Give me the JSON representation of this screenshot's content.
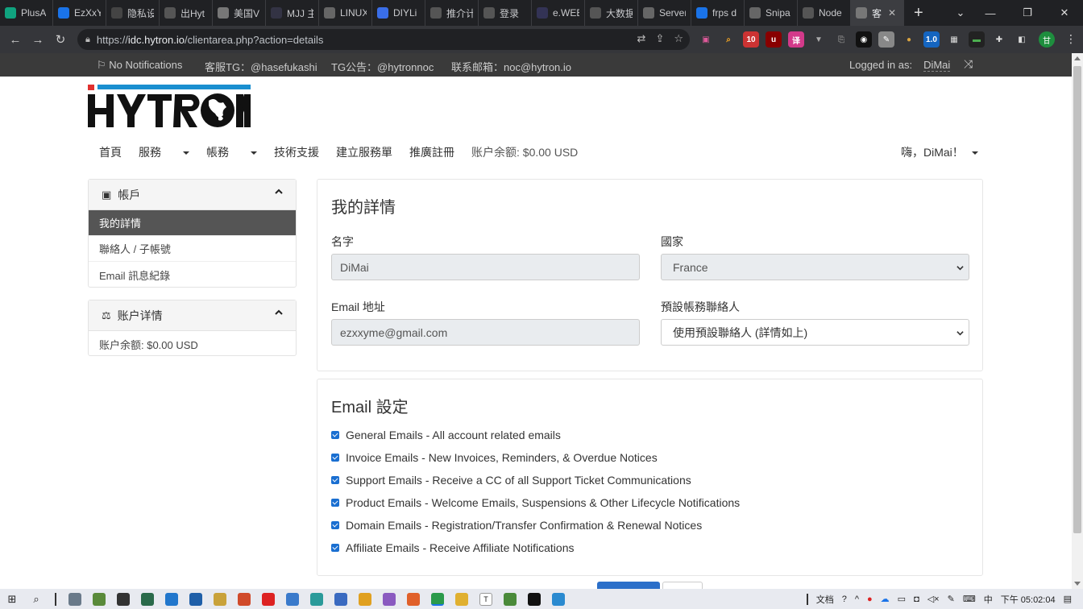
{
  "browser": {
    "tabs": [
      {
        "title": "PlusA",
        "color": "#10a37f",
        "w": 66
      },
      {
        "title": "EzXxY",
        "color": "#1a73e8",
        "w": 66
      },
      {
        "title": "隐私设置链",
        "color": "#444",
        "w": 66
      },
      {
        "title": "出Hyt",
        "color": "#555",
        "w": 66
      },
      {
        "title": "美国V",
        "color": "#777",
        "w": 66
      },
      {
        "title": "MJJ 主",
        "color": "#334",
        "w": 66
      },
      {
        "title": "LINUX",
        "color": "#666",
        "w": 66
      },
      {
        "title": "DIYLi",
        "color": "#3a6ee8",
        "w": 66
      },
      {
        "title": "推介计",
        "color": "#555",
        "w": 66
      },
      {
        "title": "登录",
        "color": "#555",
        "w": 66
      },
      {
        "title": "e.WEB",
        "color": "#335",
        "w": 66
      },
      {
        "title": "大数据",
        "color": "#555",
        "w": 66
      },
      {
        "title": "Server",
        "color": "#666",
        "w": 66
      },
      {
        "title": "frps d",
        "color": "#1a73e8",
        "w": 66
      },
      {
        "title": "Snipa",
        "color": "#666",
        "w": 66
      },
      {
        "title": "Node",
        "color": "#555",
        "w": 66
      },
      {
        "title": "客",
        "color": "#777",
        "w": 66,
        "active": true
      }
    ],
    "address": "https://idc.hytron.io/clientarea.php?action=details",
    "address_host": "idc.hytron.io",
    "address_prefix": "https://",
    "address_path": "/clientarea.php?action=details",
    "profile_initial": "甘"
  },
  "topbar": {
    "notifications": "No Notifications",
    "support_tg": "客服TG：@hasefukashi",
    "tg_announce": "TG公告：@hytronnoc",
    "email": "联系邮箱：noc@hytron.io",
    "logged_in_label": "Logged in as:",
    "logged_in_user": "DiMai"
  },
  "nav": {
    "home": "首頁",
    "services": "服務",
    "billing": "帳務",
    "support": "技術支援",
    "ticket": "建立服務單",
    "affiliate": "推廣註冊",
    "balance": "账户余额: $0.00 USD",
    "greeting": "嗨，DiMai！"
  },
  "sidebar": {
    "account": {
      "title": "帳戶",
      "items": [
        "我的詳情",
        "聯絡人 / 子帳號",
        "Email 訊息紀錄"
      ]
    },
    "details": {
      "title": "账户详情",
      "balance": "账户余额: $0.00 USD"
    }
  },
  "details_card": {
    "title": "我的詳情",
    "name_label": "名字",
    "name_value": "DiMai",
    "country_label": "國家",
    "country_value": "France",
    "email_label": "Email 地址",
    "email_value": "ezxxyme@gmail.com",
    "contact_label": "預設帳務聯絡人",
    "contact_value": "使用預設聯絡人 (詳情如上)"
  },
  "email_card": {
    "title": "Email 設定",
    "options": [
      "General Emails - All account related emails",
      "Invoice Emails - New Invoices, Reminders, & Overdue Notices",
      "Support Emails - Receive a CC of all Support Ticket Communications",
      "Product Emails - Welcome Emails, Suspensions & Other Lifecycle Notifications",
      "Domain Emails - Registration/Transfer Confirmation & Renewal Notices",
      "Affiliate Emails - Receive Affiliate Notifications"
    ]
  },
  "taskbar": {
    "doc_label": "文档",
    "ime": "中",
    "time": "下午 05:02:04"
  },
  "colors": {
    "topbar": "#3a3a3a",
    "active_item": "#555555",
    "checkbox": "#1a6fd1",
    "logo_blue": "#1a8fd0",
    "logo_red": "#e0312f"
  }
}
